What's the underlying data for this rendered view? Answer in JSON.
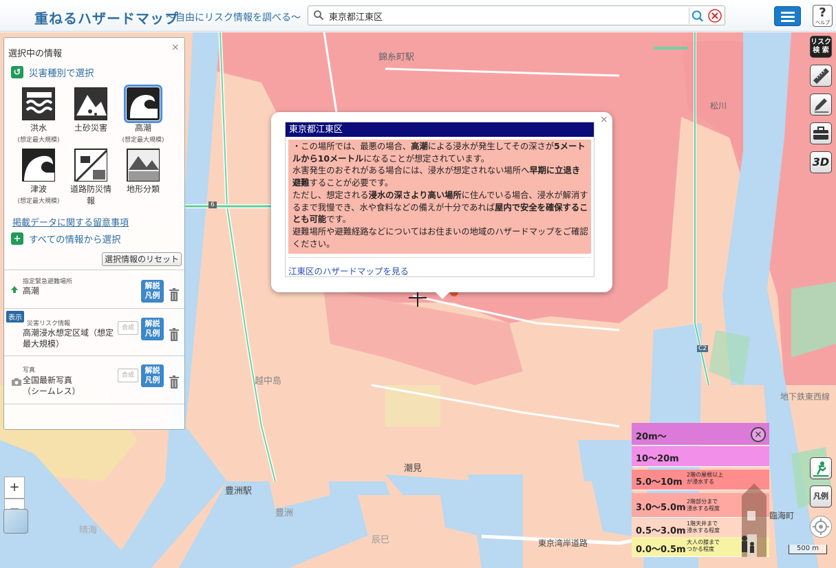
{
  "header": {
    "title": "重ねるハザードマップ",
    "subtitle": "～自由にリスク情報を調べる～",
    "search_value": "東京都江東区",
    "help_label": "ヘルプ"
  },
  "panel": {
    "title": "選択中の情報",
    "close": "×",
    "section_disaster": "災害種別で選択",
    "hazards": [
      {
        "label": "洪水",
        "sub": "(想定最大規模)"
      },
      {
        "label": "土砂災害",
        "sub": ""
      },
      {
        "label": "高潮",
        "sub": "(想定最大規模)"
      },
      {
        "label": "津波",
        "sub": "(想定最大規模)"
      },
      {
        "label": "道路防災情報",
        "sub": ""
      },
      {
        "label": "地形分類",
        "sub": ""
      }
    ],
    "notes_link": "掲載データに関する留意事項",
    "section_all": "すべての情報から選択",
    "reset_button": "選択情報のリセット",
    "layers": [
      {
        "category": "指定緊急避難場所",
        "name": "高潮",
        "legend_label_1": "解説",
        "legend_label_2": "凡例"
      },
      {
        "badge": "表示",
        "category": "災害リスク情報",
        "name_1": "高潮浸水想定区域（想定",
        "name_2": "最大規模）",
        "compose": "合成",
        "legend_label_1": "解説",
        "legend_label_2": "凡例"
      },
      {
        "category": "写真",
        "name_1": "全国最新写真",
        "name_2": "（シームレス）",
        "compose": "合成",
        "legend_label_1": "解説",
        "legend_label_2": "凡例"
      }
    ]
  },
  "popup": {
    "heading": "東京都江東区",
    "close": "×",
    "link": "江東区のハザードマップを見る"
  },
  "tools": {
    "risk_search_1": "リスク",
    "risk_search_2": "検 索",
    "three_d": "3D"
  },
  "legend": {
    "close": "×",
    "rows": [
      {
        "label": "20m～",
        "desc_1": "",
        "desc_2": "",
        "color": "#dc7ad9"
      },
      {
        "label": "10～20m",
        "desc_1": "",
        "desc_2": "",
        "color": "#f28fe8"
      },
      {
        "label": "5.0～10m",
        "desc_1": "2階の屋根以上",
        "desc_2": "が浸水する",
        "color": "#ff8d8e"
      },
      {
        "label": "3.0～5.0m",
        "desc_1": "2階部分まで",
        "desc_2": "浸水する程度",
        "color": "#ffa8a2"
      },
      {
        "label": "0.5～3.0m",
        "desc_1": "1階天井まで",
        "desc_2": "浸水する程度",
        "color": "#ffd6c4"
      },
      {
        "label": "0.0～0.5m",
        "desc_1": "大人の膝まで",
        "desc_2": "つかる程度",
        "color": "#f7f3a5"
      }
    ]
  },
  "map_labels": {
    "kinshicho": "錦糸町駅",
    "matsukawa": "松川",
    "shiomi": "潮見",
    "toyosu": "豊洲駅",
    "toyosu2": "豊洲",
    "etchujima": "越中島",
    "bay_road": "東京湾岸道路",
    "rinkai": "臨海町",
    "subway": "地下鉄東西線",
    "harumi": "晴海",
    "tatsumi": "辰巳",
    "c2": "C2",
    "r6": "6"
  },
  "controls": {
    "zoom_in": "+",
    "zoom_out": "−",
    "scale": "500 m",
    "legend_btn": "凡例"
  },
  "colors": {
    "accent": "#2d6ea3",
    "flood_pink": "#f7a1a4",
    "flood_peach": "#fbd0b8",
    "water": "#b9d8f1"
  }
}
